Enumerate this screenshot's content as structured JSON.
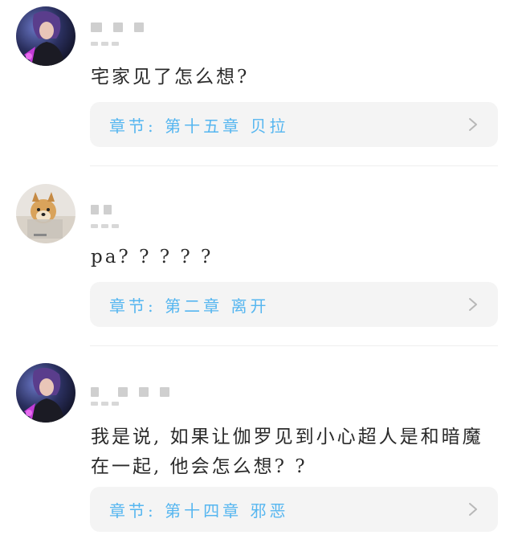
{
  "comments": [
    {
      "text": "宅家见了怎么想?",
      "chapter_label": "章节: 第十五章 贝拉"
    },
    {
      "text": "pa? ? ? ? ?",
      "chapter_label": "章节: 第二章 离开"
    },
    {
      "text": "我是说, 如果让伽罗见到小心超人是和暗魔在一起, 他会怎么想? ?",
      "chapter_label": "章节: 第十四章 邪恶"
    }
  ],
  "icons": {
    "chapter_arrow": "chevron-right-icon"
  },
  "colors": {
    "chapter_text": "#56b6f0",
    "chapter_bg": "#f4f4f4"
  }
}
